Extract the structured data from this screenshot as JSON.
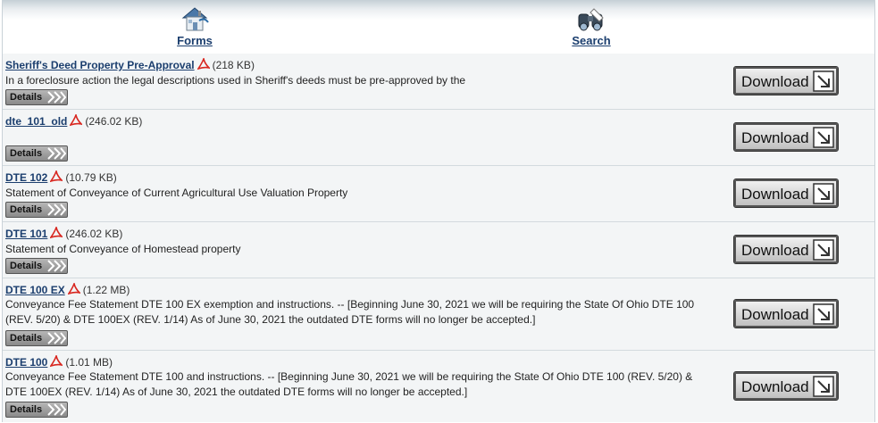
{
  "nav": {
    "forms_label": "Forms",
    "search_label": "Search"
  },
  "forms": [
    {
      "title": "Sheriff's Deed Property Pre-Approval",
      "size": "(218 KB)",
      "description": "In a foreclosure action the legal descriptions used in Sheriff's deeds must be pre-approved by the",
      "details_label": "Details",
      "download_label": "Download"
    },
    {
      "title": "dte_101_old",
      "size": "(246.02 KB)",
      "description": "",
      "details_label": "Details",
      "download_label": "Download"
    },
    {
      "title": "DTE 102",
      "size": "(10.79 KB)",
      "description": "Statement of Conveyance of Current Agricultural Use Valuation Property",
      "details_label": "Details",
      "download_label": "Download"
    },
    {
      "title": "DTE 101",
      "size": "(246.02 KB)",
      "description": "Statement of Conveyance of Homestead property",
      "details_label": "Details",
      "download_label": "Download"
    },
    {
      "title": "DTE 100 EX",
      "size": "(1.22 MB)",
      "description": "Conveyance Fee Statement DTE 100 EX exemption and instructions. -- [Beginning June 30, 2021 we will be requiring the State Of Ohio DTE 100 (REV. 5/20) & DTE 100EX (REV. 1/14) As of June 30, 2021 the outdated DTE forms will no longer be accepted.]",
      "details_label": "Details",
      "download_label": "Download"
    },
    {
      "title": "DTE 100",
      "size": "(1.01 MB)",
      "description": "Conveyance Fee Statement DTE 100 and instructions. -- [Beginning June 30, 2021 we will be requiring the State Of Ohio DTE 100 (REV. 5/20) & DTE 100EX (REV. 1/14) As of June 30, 2021 the outdated DTE forms will no longer be accepted.]",
      "details_label": "Details",
      "download_label": "Download"
    }
  ],
  "icons": {
    "forms": "house-icon",
    "search": "binoculars-icon",
    "pdf": "pdf-icon",
    "details": "double-chevron-icon",
    "download": "download-arrow-icon"
  }
}
